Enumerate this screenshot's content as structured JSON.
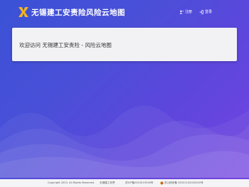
{
  "header": {
    "logo_icon": "kh-logo-icon",
    "title": "无锡建工安责险风险云地图",
    "nav": [
      {
        "label": "注册",
        "icon": "user-add-icon"
      },
      {
        "label": "登录",
        "icon": "login-icon"
      }
    ]
  },
  "main": {
    "welcome_text": "欢迎访问 无锡建工安责险 - 风险云地图"
  },
  "footer": {
    "copyright": "Copyright 2023. All Rights Reserved.",
    "org": "无锡建工安责",
    "icp": "苏ICP备2023019316号",
    "police": "苏公网安备 32021102002002号",
    "police_icon": "police-badge-icon"
  },
  "colors": {
    "bg_start": "#3a52d6",
    "bg_end": "#7444e0",
    "card": "#f2f2f4",
    "footer": "#f4f4f6"
  }
}
